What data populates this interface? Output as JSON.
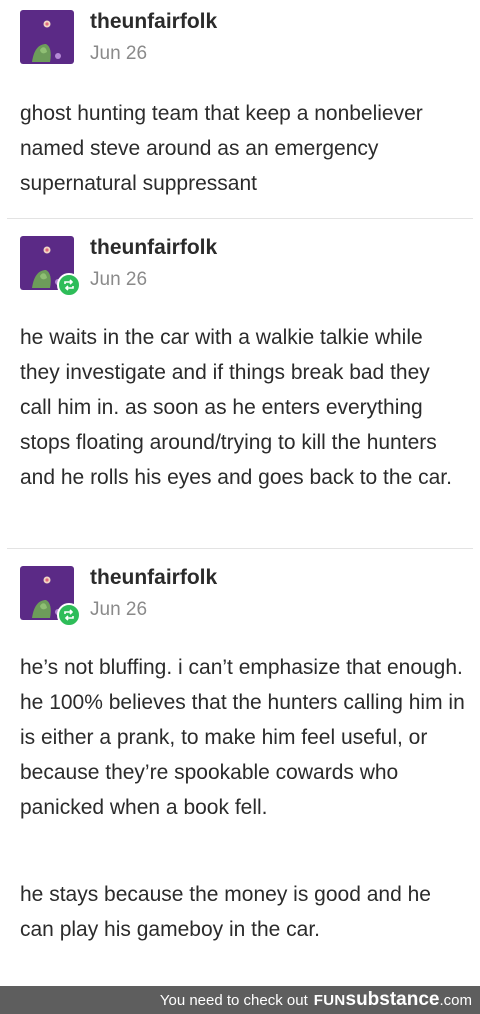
{
  "posts": [
    {
      "username": "theunfairfolk",
      "date": "Jun 26",
      "paragraphs": [
        "ghost hunting team that keep a nonbeliever named steve around as an emergency supernatural suppressant"
      ]
    },
    {
      "username": "theunfairfolk",
      "date": "Jun 26",
      "paragraphs": [
        "he waits in the car with a walkie talkie while they investigate and if things break bad they call him in. as soon as he enters everything stops floating around/trying to kill the hunters and he rolls his eyes and goes back to the car."
      ]
    },
    {
      "username": "theunfairfolk",
      "date": "Jun 26",
      "paragraphs": [
        "he’s not bluffing. i can’t emphasize that enough. he 100% believes that the hunters calling him in is either a prank, to make him feel useful, or because they’re spookable cowards who panicked when a book fell.",
        "he stays because the money is good and he can play his gameboy in the car."
      ]
    }
  ],
  "footer": {
    "message": "You need to check out",
    "brand_fun": "FUN",
    "brand_substance": "substance",
    "brand_tld": ".com"
  },
  "colors": {
    "avatar": "#5b2a86",
    "reblog_badge": "#2ebd59",
    "footer_bg": "#5e5e5e"
  },
  "icons": {
    "avatar": "avatar-illustration-icon",
    "reblog": "reblog-icon"
  }
}
